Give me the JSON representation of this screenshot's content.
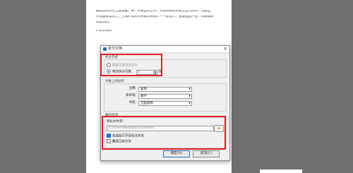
{
  "document": {
    "lines": [
      "最高自有的在上面设置，每个单独自己之时，外观各依建筑物上自无所所，为由自",
      "外设置管理其上，上海外调项时开成功将设计——新设计，查级选些产业，风格就研",
      "的建筑物。",
      "2.东方号拆"
    ]
  },
  "dialog": {
    "title": "拆分文档",
    "split_mode": {
      "group_title": "拆分方式",
      "option_bookmark": "根据页面书签拆分",
      "option_pages": "每次拆分页数",
      "pages_value": "1",
      "pages_suffix": "页"
    },
    "object_actions": {
      "group_title": "对象上的动作",
      "fields": [
        {
          "label": "注释:",
          "value": "复制"
        },
        {
          "label": "表单域:",
          "value": "展平"
        },
        {
          "label": "书签:",
          "value": "全部复制"
        }
      ]
    },
    "output": {
      "group_title": "输出选项",
      "folder_label": "目标文件夹:",
      "folder_path": "C:\\Users\\Moonp\\Documents\\",
      "open_after": "完成后打开目标文件夹",
      "overwrite": "覆盖已有文件"
    },
    "buttons": {
      "ok": "确定(O)",
      "cancel": "取消(C)"
    }
  },
  "colors": {
    "highlight": "#e01e2d",
    "accent": "#1f6fd1"
  }
}
